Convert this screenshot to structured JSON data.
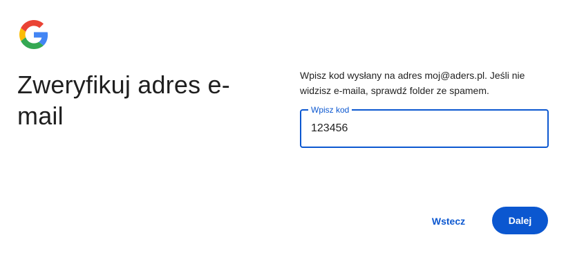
{
  "logo": {
    "icon": "google-g-icon"
  },
  "heading": {
    "title": "Zweryfikuj adres e-mail"
  },
  "description": {
    "text": "Wpisz kod wysłany na adres moj@aders.pl. Jeśli nie widzisz e-maila, sprawdź folder ze spamem."
  },
  "code_field": {
    "label": "Wpisz kod",
    "value": "123456"
  },
  "actions": {
    "back_label": "Wstecz",
    "next_label": "Dalej"
  },
  "colors": {
    "accent": "#0b57d0",
    "text": "#1f1f1f",
    "background": "#ffffff"
  }
}
